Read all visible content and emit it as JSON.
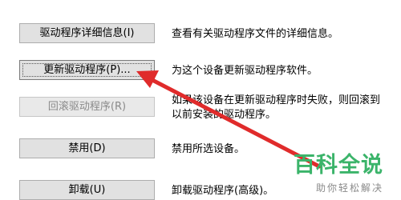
{
  "buttons": [
    {
      "label": "驱动程序详细信息(I)",
      "description": "查看有关驱动程序文件的详细信息。",
      "enabled": true
    },
    {
      "label": "更新驱动程序(P)...",
      "description": "为这个设备更新驱动程序软件。",
      "enabled": true,
      "focused": true
    },
    {
      "label": "回滚驱动程序(R)",
      "description": "如果该设备在更新驱动程序时失败，则回滚到\n以前安装的驱动程序。",
      "enabled": false
    },
    {
      "label": "禁用(D)",
      "description": "禁用所选设备。",
      "enabled": true
    },
    {
      "label": "卸载(U)",
      "description": "卸载驱动程序(高级)。",
      "enabled": true
    }
  ],
  "rollback_description_lines": [
    "如果该设备在更新驱动程序时失败，则回滚到",
    "以前安装的驱动程序。"
  ],
  "watermark": {
    "title": "百科全说",
    "subtitle": "助你轻松解决"
  },
  "annotation": {
    "type": "arrow",
    "color": "#e02b2b",
    "points_to": "update-driver-button"
  }
}
